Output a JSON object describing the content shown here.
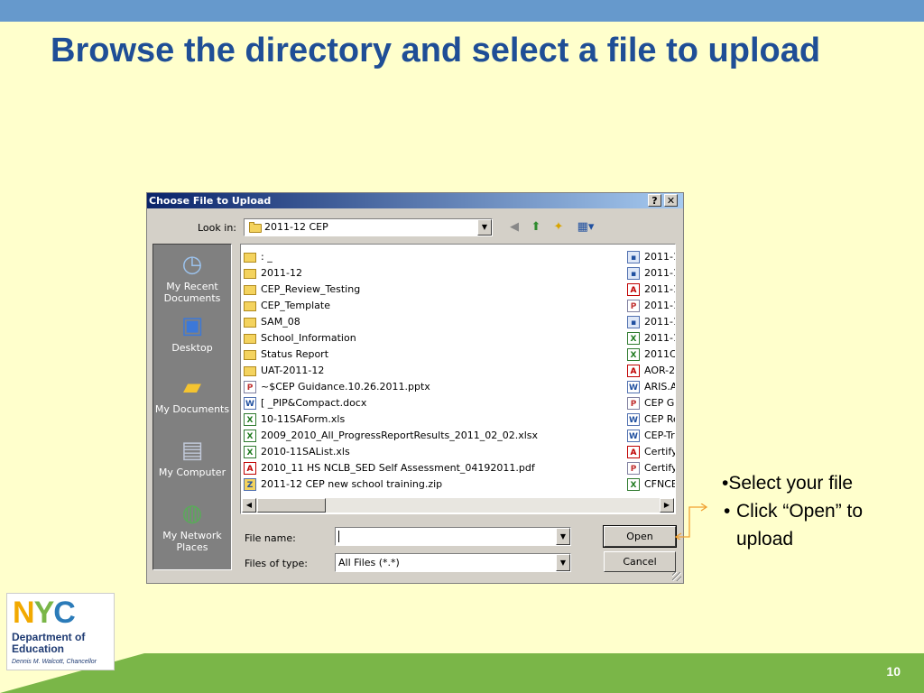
{
  "slide": {
    "title": "Browse the directory and select a file to upload",
    "number": "10"
  },
  "dialog": {
    "title": "Choose File to Upload",
    "help_glyph": "?",
    "close_glyph": "✕",
    "look_in_label": "Look in:",
    "look_in_value": "2011-12 CEP",
    "places": [
      {
        "label": "My Recent Documents",
        "icon": "recent-documents-icon"
      },
      {
        "label": "Desktop",
        "icon": "desktop-icon"
      },
      {
        "label": "My Documents",
        "icon": "my-documents-icon"
      },
      {
        "label": "My Computer",
        "icon": "my-computer-icon"
      },
      {
        "label": "My Network Places",
        "icon": "network-places-icon"
      }
    ],
    "files_left": [
      {
        "name": ":   _",
        "type": "folder"
      },
      {
        "name": "2011-12",
        "type": "folder"
      },
      {
        "name": "CEP_Review_Testing",
        "type": "folder"
      },
      {
        "name": "CEP_Template",
        "type": "folder"
      },
      {
        "name": "SAM_08",
        "type": "folder"
      },
      {
        "name": "School_Information",
        "type": "folder"
      },
      {
        "name": "Status Report",
        "type": "folder"
      },
      {
        "name": "UAT-2011-12",
        "type": "folder"
      },
      {
        "name": "~$CEP Guidance.10.26.2011.pptx",
        "type": "pptx"
      },
      {
        "name": "[           _PIP&Compact.docx",
        "type": "docx"
      },
      {
        "name": "10-11SAForm.xls",
        "type": "xls"
      },
      {
        "name": "2009_2010_All_ProgressReportResults_2011_02_02.xlsx",
        "type": "xls"
      },
      {
        "name": "2010-11SAList.xls",
        "type": "xls"
      },
      {
        "name": "2010_11 HS NCLB_SED Self Assessment_04192011.pdf",
        "type": "pdf"
      },
      {
        "name": "2011-12 CEP new school training.zip",
        "type": "zip"
      }
    ],
    "files_right": [
      {
        "name": "2011-1",
        "type": "mon"
      },
      {
        "name": "2011-1",
        "type": "mon"
      },
      {
        "name": "2011-1",
        "type": "pdf"
      },
      {
        "name": "2011-1",
        "type": "pptx"
      },
      {
        "name": "2011-1",
        "type": "mon"
      },
      {
        "name": "2011-1",
        "type": "xls"
      },
      {
        "name": "2011C",
        "type": "xls"
      },
      {
        "name": "AOR-2",
        "type": "pdf"
      },
      {
        "name": "ARIS.A",
        "type": "docx"
      },
      {
        "name": "CEP Gu",
        "type": "pptx"
      },
      {
        "name": "CEP Re",
        "type": "docx"
      },
      {
        "name": "CEP-Tr",
        "type": "docx"
      },
      {
        "name": "Certify",
        "type": "pdf"
      },
      {
        "name": "Certify",
        "type": "pptx"
      },
      {
        "name": "CFNCE",
        "type": "xls"
      }
    ],
    "file_name_label": "File name:",
    "file_name_value": "",
    "files_of_type_label": "Files of type:",
    "files_of_type_value": "All Files (*.*)",
    "open_label": "Open",
    "cancel_label": "Cancel"
  },
  "callout": {
    "bullet1": "•Select your file",
    "bullet2_dot": "•",
    "bullet2": "Click “Open” to upload"
  },
  "logo": {
    "n": "N",
    "y": "Y",
    "c": "C",
    "line1": "Department of",
    "line2": "Education",
    "sub": "Dennis M. Walcott, Chancellor"
  },
  "colors": {
    "background": "#ffffcc",
    "title": "#1f4e96",
    "top_bar": "#6699cc",
    "footer": "#7ab648",
    "callout_line": "#f0a030"
  }
}
